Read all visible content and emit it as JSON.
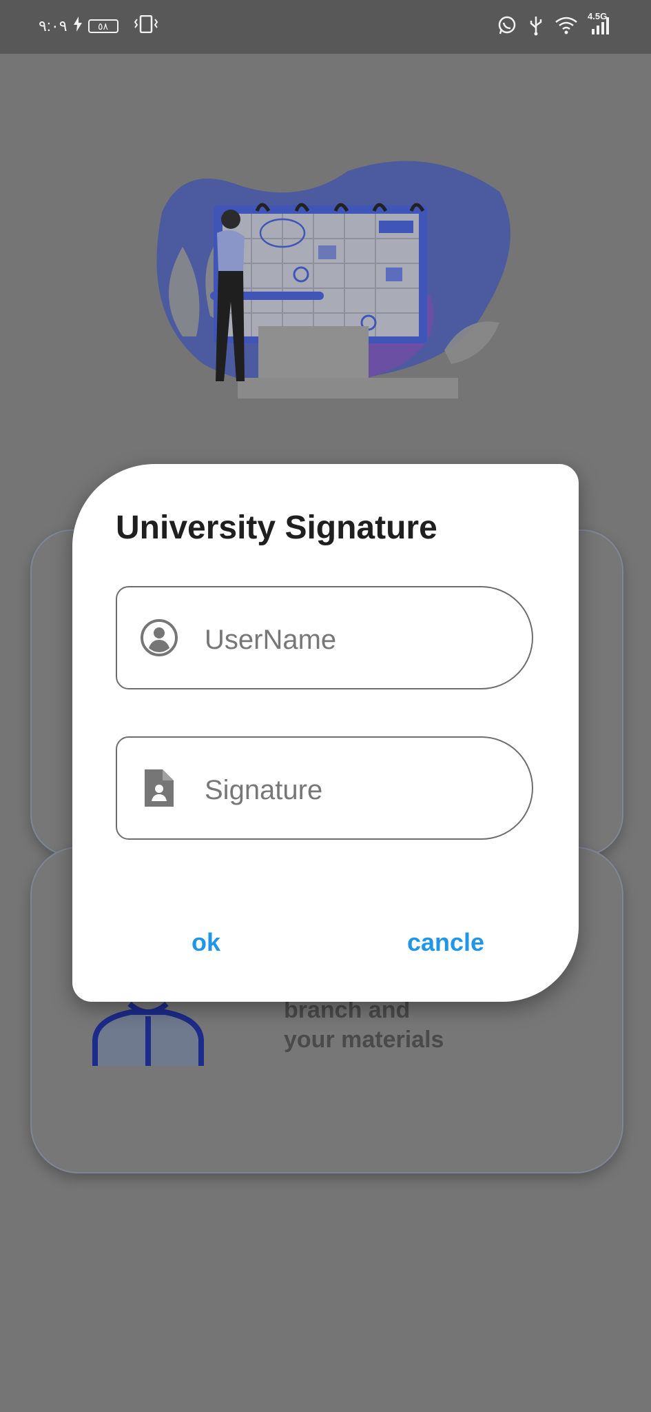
{
  "status_bar": {
    "time": "٩:٠٩",
    "battery": "٥٨",
    "network": "4.5G",
    "icons": [
      "charging-icon",
      "vibrate-icon",
      "whatsapp-icon",
      "usb-icon",
      "wifi-icon",
      "signal-icon"
    ]
  },
  "background": {
    "card_text_line1": "branch and",
    "card_text_line2": "your materials"
  },
  "dialog": {
    "title": "University Signature",
    "username_placeholder": "UserName",
    "signature_placeholder": "Signature",
    "ok_label": "ok",
    "cancel_label": "cancle"
  },
  "colors": {
    "accent": "#2196e8",
    "scrim": "#757575",
    "dialog_bg": "#ffffff"
  }
}
